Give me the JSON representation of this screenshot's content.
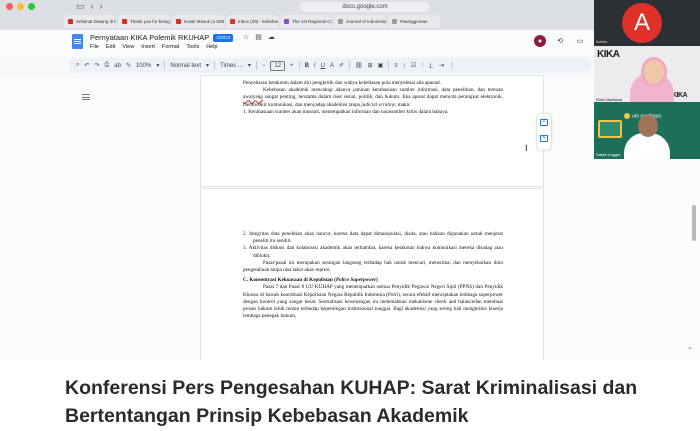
{
  "browser": {
    "url": "docs.google.com",
    "tabs": [
      {
        "label": "Selamat Datang di Porta...",
        "color": "#d93025"
      },
      {
        "label": "Thank you for being par...",
        "color": "#d93025"
      },
      {
        "label": "Kotak Masuk (1.508) - s...",
        "color": "#d93025"
      },
      {
        "label": "Inbox (39) - kebebasan...",
        "color": "#d93025"
      },
      {
        "label": "The 1st Regional Confer...",
        "color": "#7e57c2"
      },
      {
        "label": "Journal of Indonesian H...",
        "color": "#9e9e9e"
      },
      {
        "label": "#searggrosan",
        "color": "#9e9e9e"
      }
    ]
  },
  "docs": {
    "title": "Pernyataan KIKA Polemik RKUHAP",
    "badge": ".DOCX",
    "menu": [
      "File",
      "Edit",
      "View",
      "Insert",
      "Format",
      "Tools",
      "Help"
    ],
    "zoom": "100%",
    "style": "Normal text",
    "font": "Times ...",
    "font_size": "12"
  },
  "page1": {
    "line0": "Penyebaran ketakutan dalam diri pengkritik dan wabya kebebasan pula menyelesai ada apanad.",
    "para1_a": "Kebebasan akademik mencakup adanya jaminan kerahasiaan sumber informasi, data penelitian, dan temuan ",
    "para1_awal": "awalyang",
    "para1_b": " sangat penting, terutama dalam riset sosial, politik, dan hukum. Jika aparat dapat menyita perangkat elektronik, membobkir komunikasi, dan menyadap akademisi tanpa ",
    "para1_ital": "judicial scrutiny",
    "para1_c": ", maka:",
    "item1": "1.  Kerahasiaan sumber akan musnah, menempatkan informan dan narasumber kritis dalam bahaya."
  },
  "page2": {
    "item2": "2.  Integritas data penelitian akan hancur, karena data dapat dimanipulasi, disita, atau bahkan digunakan untuk menjerat peneliti itu sendiri.",
    "item3": "3.  Aktivitas diskusi dan kolaborasi akademik akan terhambat, karena ketakutan bahwa komunikasi mereka disadap atau dibiokir.",
    "para2": "Pasal-pasal ini merupakan serangan langsung terhadap hak untuk mencari, menerima, dan menyebarkan ilmu pengetahuan tanpa rasa takut akan represi.",
    "heading": "C. Konsentrasi Kekuasaan di Kepolisian (",
    "heading_ital": "Police Superpower",
    "heading_end": ")",
    "para3": "Pasal 7 dan Pasal 8 UU KUHAP yang menempatkan semua Penyidik Pegawai Negeri Sipil (PPNS) dan Penyidik Khusus di bawah koordinasi Kepolisian Negara Republik Indonesia (Polri), secara efektif menciptakan lembaga superpower dengan kontrol yang sangat besar. Sentralisasi kewenangan ini melemahkan mekanisme check and balancedan membuat proses hukum lebih rentan terhadap kepentingan institusional tunggal. Bagi akademisi yang sering kali mengkritisi kinerja lembaga penegak hukum,"
  },
  "meeting": {
    "tileA_letter": "A",
    "tileA_name": "Admin",
    "tileB_name": "Rina Mardiana",
    "kika": "KIKA",
    "tileC_logo": "um surabaya",
    "tileC_name": "Satria Unggul"
  },
  "article": {
    "headline": "Konferensi Pers Pengesahan KUHAP: Sarat Kriminalisasi dan Bertentangan Prinsip Kebebasan Akademik"
  }
}
